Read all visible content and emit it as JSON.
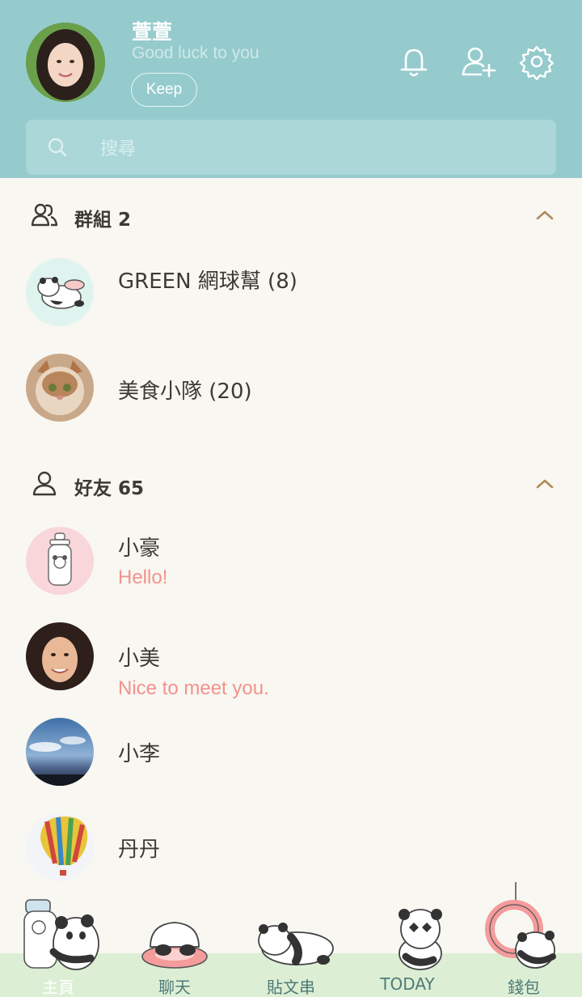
{
  "profile": {
    "name": "萱萱",
    "status": "Good luck to you",
    "keep_label": "Keep"
  },
  "header_icons": [
    "bell-icon",
    "add-friend-icon",
    "gear-icon"
  ],
  "search": {
    "placeholder": "搜尋"
  },
  "groups": {
    "title": "群組 2",
    "items": [
      {
        "name": "GREEN 網球幫 (8)",
        "avatar": "panda-sticker"
      },
      {
        "name": "美食小隊 (20)",
        "avatar": "cat-photo"
      }
    ]
  },
  "friends": {
    "title": "好友 65",
    "items": [
      {
        "name": "小豪",
        "status": "Hello!",
        "avatar": "panda-bottle"
      },
      {
        "name": "小美",
        "status": "Nice to meet you.",
        "avatar": "woman-photo"
      },
      {
        "name": "小李",
        "avatar": "sky-photo"
      },
      {
        "name": "丹丹",
        "avatar": "balloon-photo"
      }
    ]
  },
  "nav": {
    "items": [
      {
        "label": "主頁",
        "active": true
      },
      {
        "label": "聊天"
      },
      {
        "label": "貼文串"
      },
      {
        "label": "TODAY"
      },
      {
        "label": "錢包"
      }
    ]
  },
  "colors": {
    "header_bg": "#96cbcd",
    "page_bg": "#f9f7f1",
    "status_pink": "#f2928f",
    "nav_bg": "#dcefd5",
    "chevron": "#b08a5a"
  }
}
